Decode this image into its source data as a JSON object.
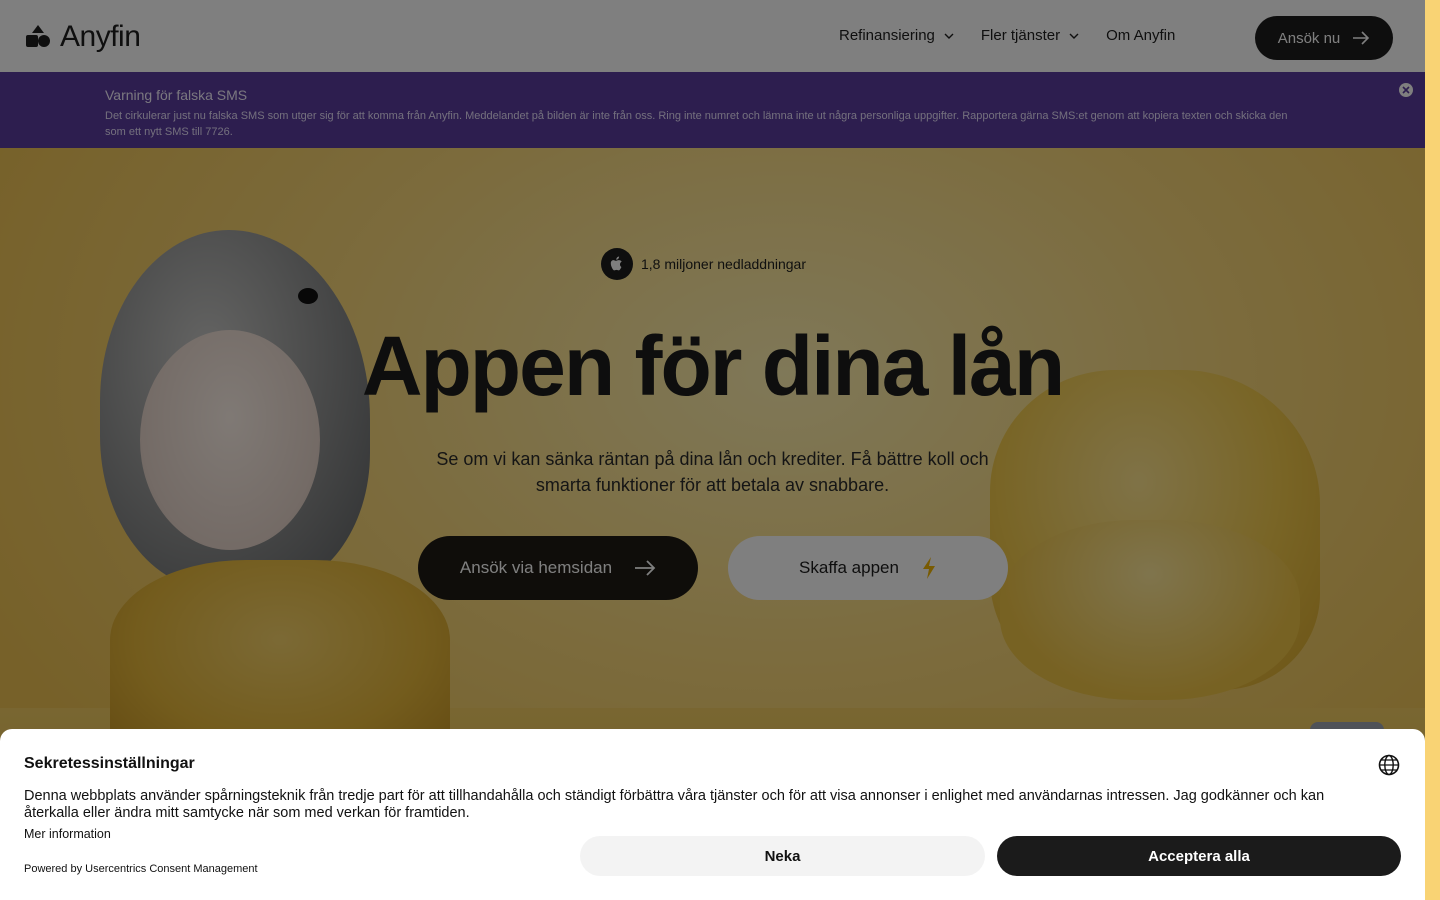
{
  "header": {
    "logo_text": "Anyfin",
    "nav": [
      {
        "label": "Refinansiering"
      },
      {
        "label": "Fler tjänster"
      },
      {
        "label": "Om Anyfin"
      }
    ],
    "cta_label": "Ansök nu"
  },
  "banner": {
    "title": "Varning för falska SMS",
    "text": "Det cirkulerar just nu falska SMS som utger sig för att komma från Anyfin. Meddelandet på bilden är inte från oss. Ring inte numret och lämna inte ut några personliga uppgifter. Rapportera gärna SMS:et genom att kopiera texten och skicka den som ett nytt SMS till 7726."
  },
  "hero": {
    "badge": "1,8 miljoner nedladdningar",
    "headline": "Appen för dina lån",
    "subtext": "Se om vi kan sänka räntan på dina lån och krediter. Få bättre koll och smarta funktioner för att betala av snabbare.",
    "primary_label": "Ansök via hemsidan",
    "secondary_label": "Skaffa appen"
  },
  "consent": {
    "title": "Sekretessinställningar",
    "text": "Denna webbplats använder spårningsteknik från tredje part för att tillhandahålla och ständigt förbättra våra tjänster och för att visa annonser i enlighet med användarnas intressen. Jag godkänner och kan återkalla eller ändra mitt samtycke när som med verkan för framtiden.",
    "more_info": "Mer information",
    "powered_by": "Powered by Usercentrics Consent Management",
    "deny_label": "Neka",
    "accept_label": "Acceptera alla"
  },
  "colors": {
    "banner_bg": "#5b3d9e",
    "hero_bg": "#f4c95a",
    "dark": "#1c1c1c"
  }
}
